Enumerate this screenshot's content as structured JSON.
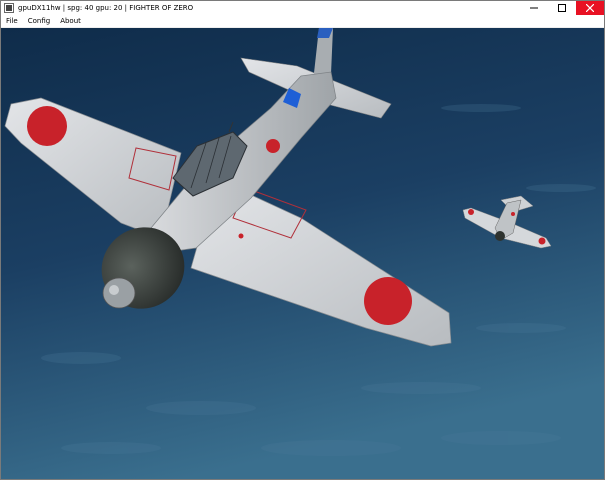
{
  "window": {
    "title": "gpuDX11hw | spg: 40 gpu: 20 | FIGHTER OF ZERO",
    "controls": [
      "minimize",
      "maximize",
      "close"
    ]
  },
  "menu": {
    "items": [
      {
        "label": "File"
      },
      {
        "label": "Config"
      },
      {
        "label": "About"
      }
    ]
  },
  "icons": {
    "app": "app-icon",
    "minimize": "minimize-icon",
    "maximize": "maximize-icon",
    "close": "close-icon"
  },
  "colors": {
    "close_button": "#e81123",
    "ocean": "#1a3a5c",
    "aircraft_body": "#c9cccf",
    "roundel": "#c8222a",
    "cowling": "#3a403c",
    "fuselage_band": "#1e5fd6"
  }
}
